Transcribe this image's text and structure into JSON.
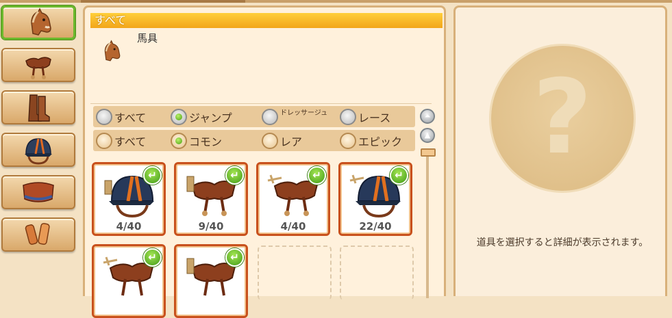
{
  "category_buttons": [
    {
      "name": "horse",
      "icon": "horse-head-icon",
      "selected": true
    },
    {
      "name": "saddle",
      "icon": "saddle-icon",
      "selected": false
    },
    {
      "name": "boots",
      "icon": "boots-icon",
      "selected": false
    },
    {
      "name": "helmet",
      "icon": "helmet-icon",
      "selected": false
    },
    {
      "name": "saddle-pad",
      "icon": "saddle-pad-icon",
      "selected": false
    },
    {
      "name": "leg-wraps",
      "icon": "leg-wraps-icon",
      "selected": false
    }
  ],
  "panel": {
    "title": "すべて",
    "section_label": "馬具"
  },
  "filters": {
    "discipline": [
      {
        "label": "すべて",
        "selected": false
      },
      {
        "label": "ジャンプ",
        "selected": true
      },
      {
        "label": "ドレッサージュ",
        "selected": false
      },
      {
        "label": "レース",
        "selected": false
      }
    ],
    "rarity": [
      {
        "label": "すべて",
        "selected": false
      },
      {
        "label": "コモン",
        "selected": true
      },
      {
        "label": "レア",
        "selected": false
      },
      {
        "label": "エピック",
        "selected": false
      }
    ]
  },
  "items": [
    {
      "type": "helmet-icon",
      "count": "4/40"
    },
    {
      "type": "saddle-icon",
      "count": "9/40"
    },
    {
      "type": "saddle-icon",
      "count": "4/40"
    },
    {
      "type": "helmet-icon",
      "count": "22/40"
    },
    {
      "type": "saddle-icon",
      "count": ""
    },
    {
      "type": "saddle-icon",
      "count": ""
    }
  ],
  "detail": {
    "placeholder_icon": "question-mark-icon",
    "hint": "道具を選択すると詳細が表示されます。"
  },
  "colors": {
    "accent_orange": "#f2a51a",
    "selected_green": "#6bb82c",
    "item_border": "#c8501c"
  }
}
